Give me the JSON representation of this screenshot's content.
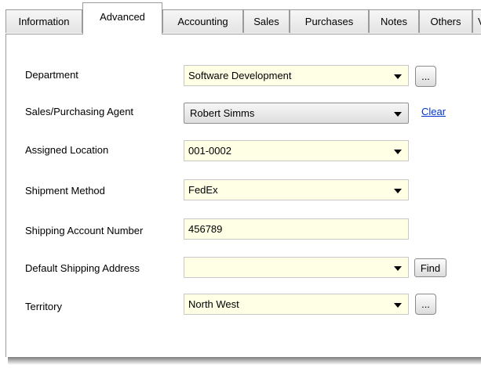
{
  "tabs": [
    {
      "label": "Information"
    },
    {
      "label": "Advanced"
    },
    {
      "label": "Accounting"
    },
    {
      "label": "Sales"
    },
    {
      "label": "Purchases"
    },
    {
      "label": "Notes"
    },
    {
      "label": "Others"
    },
    {
      "label": "V"
    }
  ],
  "active_tab": "Advanced",
  "fields": {
    "department": {
      "label": "Department",
      "value": "Software Development"
    },
    "agent": {
      "label": "Sales/Purchasing Agent",
      "value": "Robert Simms",
      "clear_link": "Clear"
    },
    "location": {
      "label": "Assigned Location",
      "value": "001-0002"
    },
    "shipment": {
      "label": "Shipment Method",
      "value": "FedEx"
    },
    "account_number": {
      "label": "Shipping Account Number",
      "value": "456789"
    },
    "shipping_address": {
      "label": "Default Shipping Address",
      "value": "",
      "find_label": "Find"
    },
    "territory": {
      "label": "Territory",
      "value": "North West"
    }
  },
  "ellipsis_label": "..."
}
